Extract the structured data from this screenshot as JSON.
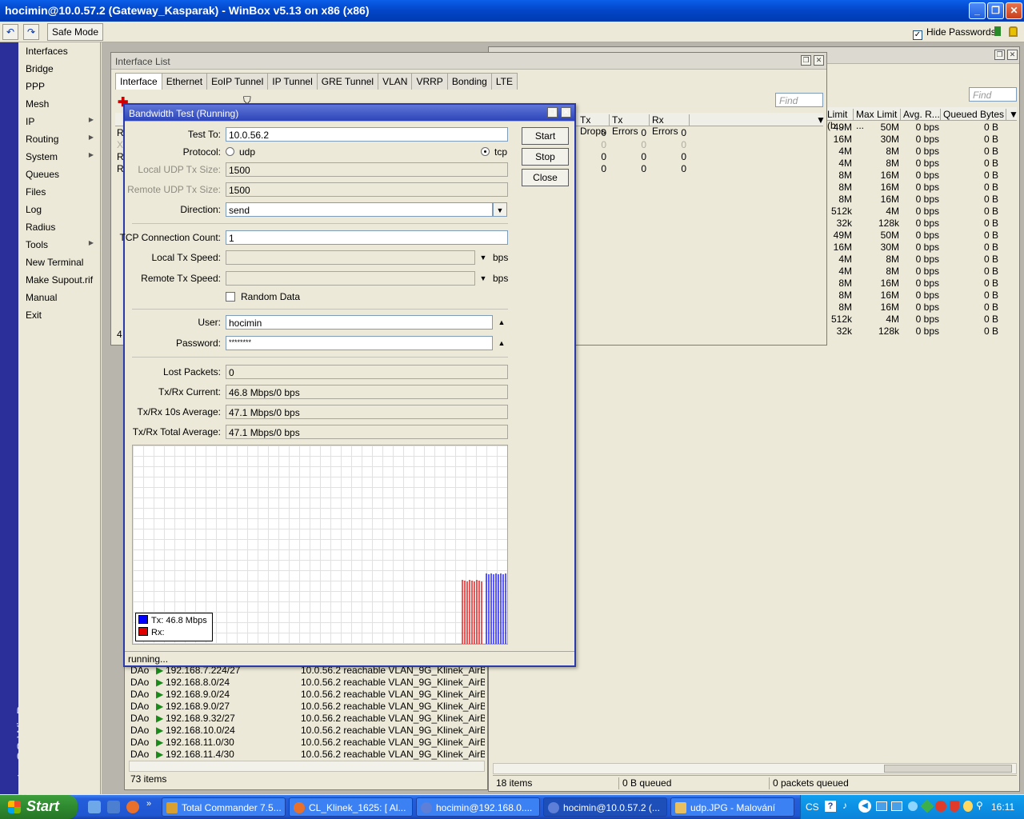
{
  "app": {
    "title": "hocimin@10.0.57.2 (Gateway_Kasparak) - WinBox v5.13 on x86 (x86)",
    "safe_mode": "Safe Mode",
    "hide_passwords": "Hide Passwords",
    "brand": "RouterOS WinBox"
  },
  "menu": [
    "Interfaces",
    "Bridge",
    "PPP",
    "Mesh",
    "IP",
    "Routing",
    "System",
    "Queues",
    "Files",
    "Log",
    "Radius",
    "Tools",
    "New Terminal",
    "Make Supout.rif",
    "Manual",
    "Exit"
  ],
  "interface_list": {
    "title": "Interface List",
    "tabs": [
      "Interface",
      "Ethernet",
      "EoIP Tunnel",
      "IP Tunnel",
      "GRE Tunnel",
      "VLAN",
      "VRRP",
      "Bonding",
      "LTE"
    ],
    "find": "Find",
    "row_prefix": [
      "R",
      "X",
      "R",
      "R"
    ],
    "columns": [
      "Tx Drops",
      "Tx Errors",
      "Rx Errors"
    ],
    "rows": [
      [
        "0",
        "0",
        "0"
      ],
      [
        "0",
        "0",
        "0"
      ],
      [
        "0",
        "0",
        "0"
      ],
      [
        "0",
        "0",
        "0"
      ]
    ],
    "count": "4"
  },
  "queue_list": {
    "find": "Find",
    "columns": [
      "Limit (b...",
      "Max Limit ...",
      "Avg. R...",
      "Queued Bytes"
    ],
    "rows": [
      [
        "49M",
        "50M",
        "0 bps",
        "0 B"
      ],
      [
        "16M",
        "30M",
        "0 bps",
        "0 B"
      ],
      [
        "4M",
        "8M",
        "0 bps",
        "0 B"
      ],
      [
        "4M",
        "8M",
        "0 bps",
        "0 B"
      ],
      [
        "8M",
        "16M",
        "0 bps",
        "0 B"
      ],
      [
        "8M",
        "16M",
        "0 bps",
        "0 B"
      ],
      [
        "8M",
        "16M",
        "0 bps",
        "0 B"
      ],
      [
        "512k",
        "4M",
        "0 bps",
        "0 B"
      ],
      [
        "32k",
        "128k",
        "0 bps",
        "0 B"
      ],
      [
        "49M",
        "50M",
        "0 bps",
        "0 B"
      ],
      [
        "16M",
        "30M",
        "0 bps",
        "0 B"
      ],
      [
        "4M",
        "8M",
        "0 bps",
        "0 B"
      ],
      [
        "4M",
        "8M",
        "0 bps",
        "0 B"
      ],
      [
        "8M",
        "16M",
        "0 bps",
        "0 B"
      ],
      [
        "8M",
        "16M",
        "0 bps",
        "0 B"
      ],
      [
        "8M",
        "16M",
        "0 bps",
        "0 B"
      ],
      [
        "512k",
        "4M",
        "0 bps",
        "0 B"
      ],
      [
        "32k",
        "128k",
        "0 bps",
        "0 B"
      ]
    ],
    "status": [
      "18 items",
      "0 B queued",
      "0 packets queued"
    ]
  },
  "routes": {
    "rows": [
      [
        "DAo",
        "192.168.7.224/27",
        "10.0.56.2 reachable VLAN_9G_Klinek_AirBQ"
      ],
      [
        "DAo",
        "192.168.8.0/24",
        "10.0.56.2 reachable VLAN_9G_Klinek_AirBQ"
      ],
      [
        "DAo",
        "192.168.9.0/24",
        "10.0.56.2 reachable VLAN_9G_Klinek_AirBQ"
      ],
      [
        "DAo",
        "192.168.9.0/27",
        "10.0.56.2 reachable VLAN_9G_Klinek_AirBQ"
      ],
      [
        "DAo",
        "192.168.9.32/27",
        "10.0.56.2 reachable VLAN_9G_Klinek_AirBQ"
      ],
      [
        "DAo",
        "192.168.10.0/24",
        "10.0.56.2 reachable VLAN_9G_Klinek_AirBQ"
      ],
      [
        "DAo",
        "192.168.11.0/30",
        "10.0.56.2 reachable VLAN_9G_Klinek_AirBQ"
      ],
      [
        "DAo",
        "192.168.11.4/30",
        "10.0.56.2 reachable VLAN_9G_Klinek_AirBQ"
      ]
    ],
    "count": "73 items"
  },
  "bwtest": {
    "title": "Bandwidth Test (Running)",
    "labels": {
      "test_to": "Test To:",
      "protocol": "Protocol:",
      "local_udp": "Local UDP Tx Size:",
      "remote_udp": "Remote UDP Tx Size:",
      "direction": "Direction:",
      "tcp_count": "TCP Connection Count:",
      "local_speed": "Local Tx Speed:",
      "remote_speed": "Remote Tx Speed:",
      "random": "Random Data",
      "user": "User:",
      "password": "Password:",
      "lost": "Lost Packets:",
      "current": "Tx/Rx Current:",
      "avg10": "Tx/Rx 10s Average:",
      "total": "Tx/Rx Total Average:",
      "bps": "bps",
      "udp": "udp",
      "tcp": "tcp"
    },
    "values": {
      "test_to": "10.0.56.2",
      "local_udp": "1500",
      "remote_udp": "1500",
      "direction": "send",
      "tcp_count": "1",
      "user": "hocimin",
      "password": "********",
      "lost": "0",
      "current": "46.8 Mbps/0 bps",
      "avg10": "47.1 Mbps/0 bps",
      "total": "47.1 Mbps/0 bps"
    },
    "buttons": {
      "start": "Start",
      "stop": "Stop",
      "close": "Close"
    },
    "legend": {
      "tx": "Tx:  46.8 Mbps",
      "rx": "Rx:"
    },
    "colors": {
      "tx": "#0000ff",
      "rx": "#e00000"
    },
    "status": "running..."
  },
  "taskbar": {
    "start": "Start",
    "tasks": [
      "Total Commander 7.5...",
      "CL_Klinek_1625: [ Al...",
      "hocimin@192.168.0....",
      "hocimin@10.0.57.2 (...",
      "udp.JPG - Malování"
    ],
    "lang": "CS",
    "clock": "16:11"
  }
}
